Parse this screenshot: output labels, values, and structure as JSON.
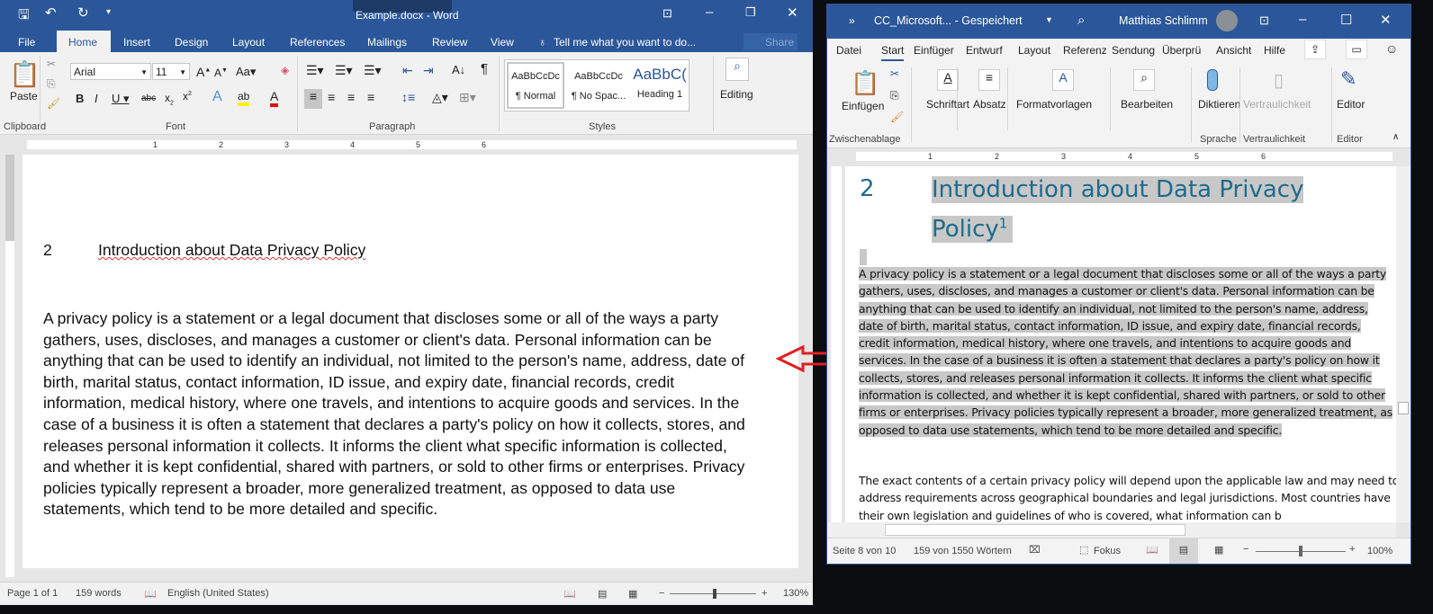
{
  "left_window": {
    "title": "Example.docx - Word",
    "tabs": [
      "File",
      "Home",
      "Insert",
      "Design",
      "Layout",
      "References",
      "Mailings",
      "Review",
      "View"
    ],
    "active_tab": "Home",
    "tell_me": "Tell me what you want to do...",
    "share": "Share",
    "font": {
      "name": "Arial",
      "size": "11"
    },
    "styles": [
      {
        "preview": "AaBbCcDc",
        "label": "¶ Normal"
      },
      {
        "preview": "AaBbCcDc",
        "label": "¶ No Spac..."
      },
      {
        "preview": "AaBbC(",
        "label": "Heading 1"
      }
    ],
    "editing": "Editing",
    "paste": "Paste",
    "groups": [
      "Clipboard",
      "Font",
      "Paragraph",
      "Styles"
    ],
    "ruler_numbers": [
      "1",
      "2",
      "3",
      "4",
      "5",
      "6"
    ],
    "heading_number": "2",
    "heading_text": "Introduction about Data Privacy Policy",
    "body": "A privacy policy is a statement or a legal document that discloses some or all of the ways a party gathers, uses, discloses, and manages a customer or client's data. Personal information can be anything that can be used to identify an individual, not limited to the person's name, address, date of birth, marital status, contact information, ID issue, and expiry date, financial records, credit information, medical history, where one travels, and intentions to acquire goods and services. In the case of a business it is often a statement that declares a party's policy on how it collects, stores, and releases personal information it collects. It informs the client what specific information is collected, and whether it is kept confidential, shared with partners, or sold to other firms or enterprises. Privacy policies typically represent a broader, more generalized treatment, as opposed to data use statements, which tend to be more detailed and specific.",
    "status": {
      "page": "Page 1 of 1",
      "words": "159 words",
      "language": "English (United States)",
      "zoom": "130%",
      "zoom_level": 130
    }
  },
  "right_window": {
    "title": "CC_Microsoft...  - Gespeichert",
    "user": "Matthias Schlimm",
    "tabs": [
      "Datei",
      "Start",
      "Einfüger",
      "Entwurf",
      "Layout",
      "Referenz",
      "Sendung",
      "Überprü",
      "Ansicht",
      "Hilfe"
    ],
    "active_tab": "Start",
    "ribbon_buttons": [
      "Einfügen",
      "Schriftart",
      "Absatz",
      "Formatvorlagen",
      "Bearbeiten",
      "Diktieren",
      "Vertraulichkeit",
      "Editor"
    ],
    "groups": [
      "Zwischenablage",
      "Sprache",
      "Vertraulichkeit",
      "Editor"
    ],
    "ruler_numbers": [
      "1",
      "2",
      "3",
      "4",
      "5",
      "6"
    ],
    "heading_number": "2",
    "heading_line1": "Introduction about Data Privacy",
    "heading_line2": "Policy",
    "footnote": "1",
    "body1": "A privacy policy is a statement or a legal document that discloses some or all of the ways a party gathers, uses, discloses, and manages a customer or client's data. Personal information can be anything that can be used to identify an individual, not limited to the person's name, address, date of birth, marital status, contact information, ID issue, and expiry date, financial records, credit information, medical history, where one travels, and intentions to acquire goods and services. In the case of a business it is often a statement that declares a party's policy on how it collects, stores, and releases personal information it collects. It informs the client what specific information is collected, and whether it is kept confidential, shared with partners, or sold to other firms or enterprises. Privacy policies typically represent a broader, more generalized treatment, as opposed to data use statements, which tend to be more detailed and specific.",
    "body2": "The exact contents of a certain privacy policy will depend upon the applicable law and may need to address requirements across geographical boundaries and legal jurisdictions. Most countries have their own legislation and guidelines of who is covered, what information can b",
    "status": {
      "page": "Seite 8 von 10",
      "words": "159 von 1550 Wörtern",
      "focus": "Fokus",
      "zoom": "100%",
      "zoom_level": 100
    }
  },
  "colors": {
    "word_blue": "#2b579a",
    "heading_blue": "#1f6b8e",
    "arrow_red": "#e02020",
    "selection": "#c8c8c8"
  }
}
